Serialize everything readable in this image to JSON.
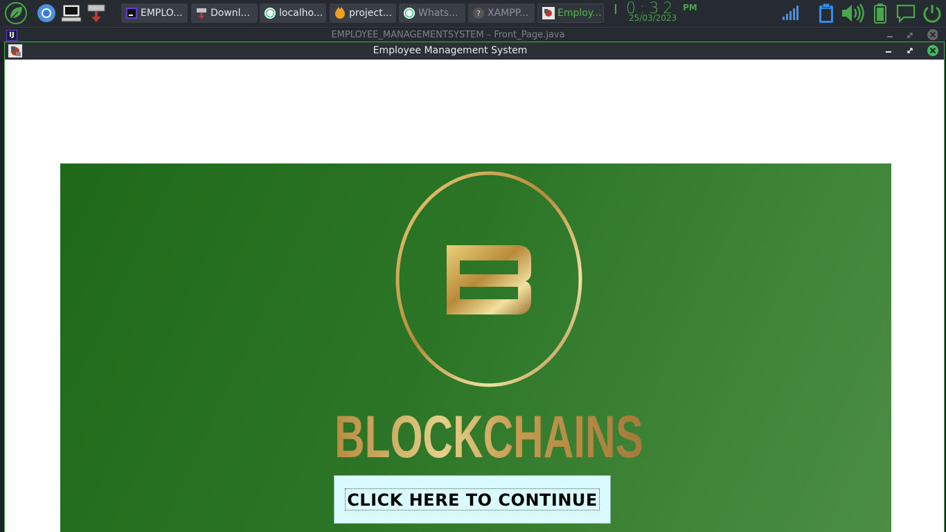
{
  "panel": {
    "launchers": [
      {
        "icon": "leaf-menu-icon"
      },
      {
        "icon": "chromium-icon"
      },
      {
        "icon": "terminal-icon"
      },
      {
        "icon": "downloader-icon"
      }
    ],
    "tasks": [
      {
        "label": "EMPLO...",
        "icon": "intellij-icon",
        "state": "normal"
      },
      {
        "label": "Downl...",
        "icon": "downloader-icon",
        "state": "normal"
      },
      {
        "label": "localho...",
        "icon": "whatsapp-icon",
        "state": "normal"
      },
      {
        "label": "project...",
        "icon": "xampp-icon",
        "state": "normal"
      },
      {
        "label": "Whats...",
        "icon": "whatsapp-icon",
        "state": "dim"
      },
      {
        "label": "XAMPP...",
        "icon": "help-icon",
        "state": "dim"
      },
      {
        "label": "Employ...",
        "icon": "java-app-icon",
        "state": "active"
      }
    ],
    "clock": {
      "time": "0:32",
      "ampm": "PM",
      "date": "25/03/2023"
    },
    "tray": [
      "signal-icon",
      "clipboard-icon",
      "volume-icon",
      "battery-icon",
      "message-icon",
      "power-icon"
    ]
  },
  "ide_window": {
    "title": "EMPLOYEE_MANAGEMENTSYSTEM – Front_Page.java"
  },
  "app_window": {
    "title": "Employee Management System",
    "banner_logo_text": "BLOCKCHAINS",
    "banner_logo_letter": "B",
    "continue_button": "CLICK HERE TO CONTINUE"
  },
  "colors": {
    "accent_green": "#4aa64a",
    "banner_green": "#2c7527",
    "gold": "#c9a24a",
    "button_bg": "#d9fbfd"
  }
}
